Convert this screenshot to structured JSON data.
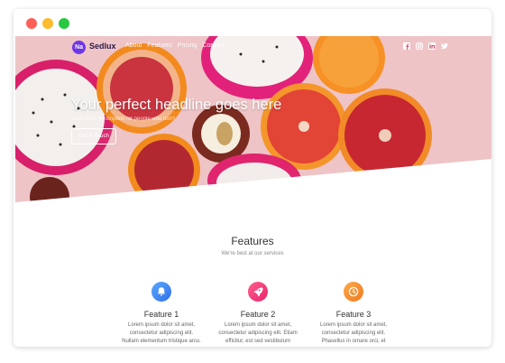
{
  "window": {
    "controls": [
      "close",
      "minimize",
      "zoom"
    ],
    "colors": {
      "close": "#fe5f57",
      "minimize": "#febc2e",
      "zoom": "#28c840"
    }
  },
  "nav": {
    "logo_text": "Na",
    "brand": "Sedlux",
    "menu": [
      "About",
      "Features",
      "Pricing",
      "Contact"
    ],
    "social_icons": [
      "facebook-icon",
      "instagram-icon",
      "linkedin-icon",
      "twitter-icon"
    ]
  },
  "hero": {
    "headline": "Your perfect headline goes here",
    "subheadline": "Cool some description for people who don't",
    "cta_label": "Get in Touch",
    "background": "photo of sliced dragon fruit and blood oranges"
  },
  "features": {
    "title": "Features",
    "subtitle": "We're best at our services",
    "items": [
      {
        "icon": "bell-icon",
        "color": "#3b8cf5",
        "title": "Feature 1",
        "line1": "Lorem ipsum dolor sit amet,",
        "line2": "consectetur adipiscing elit.",
        "line3": "Nullam elementum tristique arcu."
      },
      {
        "icon": "rocket-icon",
        "color": "#f03a7a",
        "title": "Feature 2",
        "line1": "Lorem ipsum dolor sit amet,",
        "line2": "consectetur adipiscing elit. Etiam",
        "line3": "efficitur, est sed vestibulum"
      },
      {
        "icon": "clock-icon",
        "color": "#f78a2a",
        "title": "Feature 3",
        "line1": "Lorem ipsum dolor sit amet,",
        "line2": "consectetur adipiscing elit.",
        "line3": "Phasellus in ornare orci, et"
      }
    ]
  }
}
